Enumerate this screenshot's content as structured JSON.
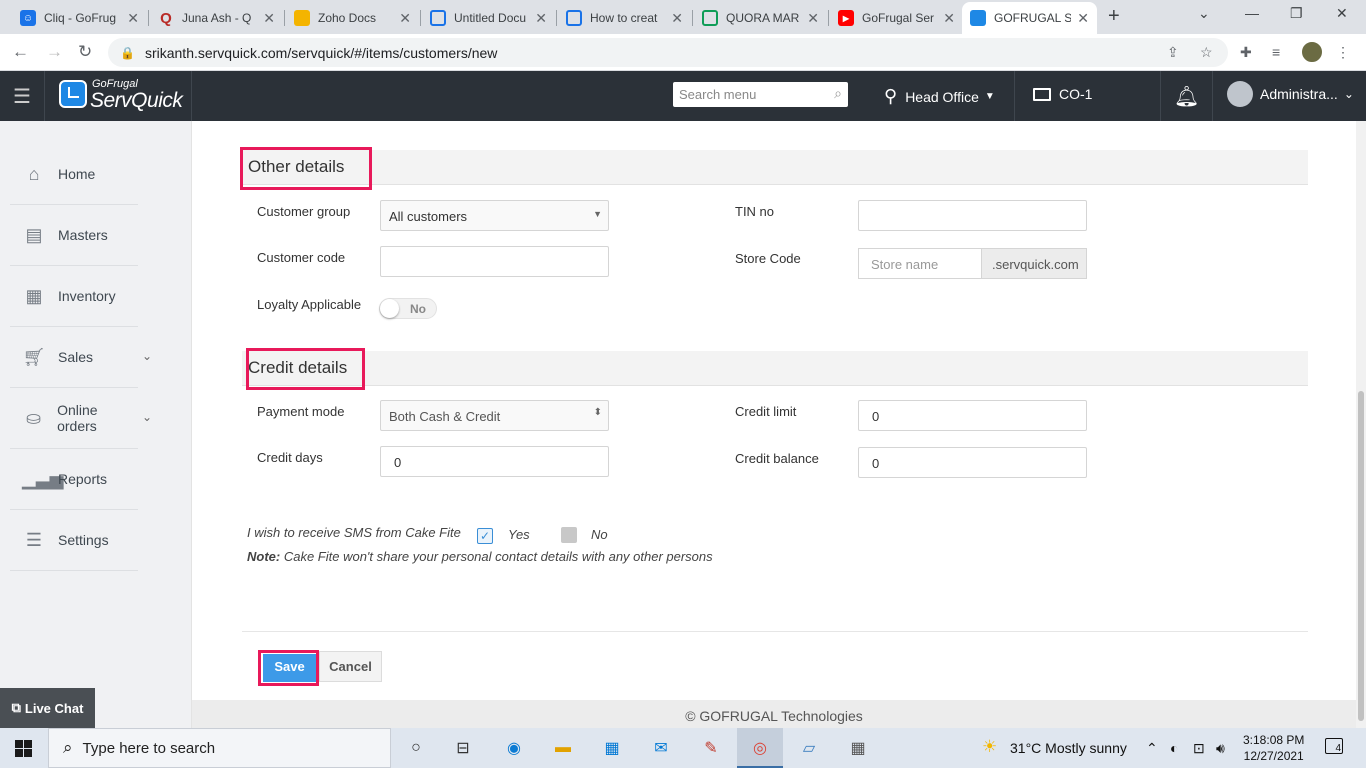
{
  "browser": {
    "tabs": [
      {
        "title": "Cliq - GoFrug",
        "fav": "chat-icon",
        "color": "#1a73e8"
      },
      {
        "title": "Juna Ash - Q",
        "fav": "quora-icon",
        "color": "#b92b27"
      },
      {
        "title": "Zoho Docs",
        "fav": "folder-icon",
        "color": "#f4b400"
      },
      {
        "title": "Untitled Docu",
        "fav": "doc-icon",
        "color": "#1a73e8"
      },
      {
        "title": "How to creat",
        "fav": "doc-icon",
        "color": "#1a73e8"
      },
      {
        "title": "QUORA MAR",
        "fav": "sheet-icon",
        "color": "#0f9d58"
      },
      {
        "title": "GoFrugal Ser",
        "fav": "youtube-icon",
        "color": "#ff0000"
      },
      {
        "title": "GOFRUGAL S",
        "fav": "servquick-icon",
        "color": "#1e88e5"
      }
    ],
    "url": "srikanth.servquick.com/servquick/#/items/customers/new"
  },
  "header": {
    "brand_sub": "GoFrugal",
    "brand_name": "ServQuick",
    "search_placeholder": "Search menu",
    "location": "Head Office",
    "counter": "CO-1",
    "user": "Administra..."
  },
  "sidebar": {
    "items": [
      {
        "label": "Home",
        "icon": "home-icon"
      },
      {
        "label": "Masters",
        "icon": "masters-icon"
      },
      {
        "label": "Inventory",
        "icon": "inventory-icon"
      },
      {
        "label": "Sales",
        "icon": "cart-icon"
      },
      {
        "label": "Online orders",
        "icon": "online-orders-icon"
      },
      {
        "label": "Reports",
        "icon": "bar-chart-icon"
      },
      {
        "label": "Settings",
        "icon": "sliders-icon"
      }
    ],
    "live_chat": "Live Chat"
  },
  "other_details": {
    "title": "Other details",
    "customer_group_label": "Customer group",
    "customer_group_value": "All customers",
    "customer_code_label": "Customer code",
    "loyalty_label": "Loyalty Applicable",
    "loyalty_value": "No",
    "tin_label": "TIN no",
    "store_code_label": "Store Code",
    "store_name_placeholder": "Store name",
    "store_domain": ".servquick.com"
  },
  "credit_details": {
    "title": "Credit details",
    "payment_mode_label": "Payment mode",
    "payment_mode_value": "Both Cash & Credit",
    "credit_days_label": "Credit days",
    "credit_days_value": "0",
    "credit_limit_label": "Credit limit",
    "credit_limit_value": "0",
    "credit_balance_label": "Credit balance",
    "credit_balance_value": "0"
  },
  "sms": {
    "question": "I wish to receive SMS from Cake Fite",
    "yes": "Yes",
    "no": "No",
    "yes_checked": true,
    "note_label": "Note:",
    "note_text": " Cake Fite won't share your personal contact details with any other persons"
  },
  "actions": {
    "save": "Save",
    "cancel": "Cancel"
  },
  "footer": "© GOFRUGAL Technologies",
  "taskbar": {
    "search_placeholder": "Type here to search",
    "weather": "31°C  Mostly sunny",
    "time": "3:18:08 PM",
    "date": "12/27/2021",
    "notifications": "4"
  },
  "highlight_color": "#e8195a"
}
